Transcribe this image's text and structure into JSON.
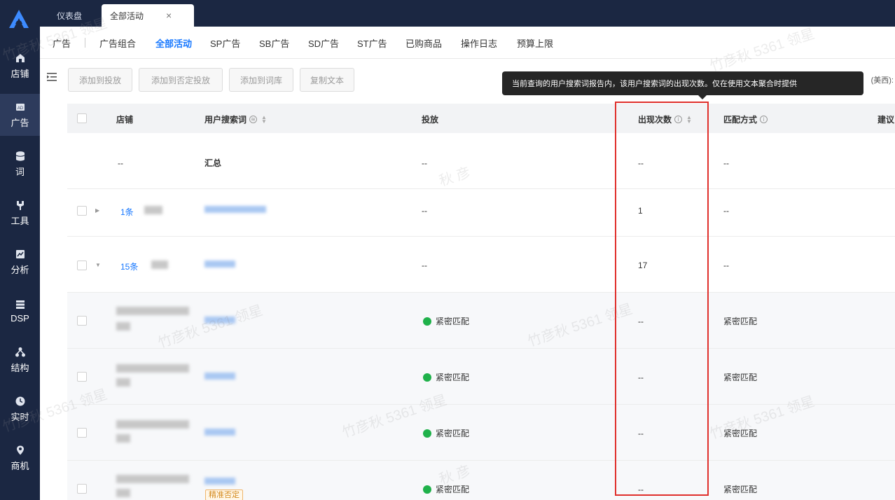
{
  "sidebar": {
    "items": [
      {
        "label": "店铺",
        "icon": "store-icon"
      },
      {
        "label": "广告",
        "icon": "ad-icon",
        "active": true
      },
      {
        "label": "词",
        "icon": "database-icon"
      },
      {
        "label": "工具",
        "icon": "tool-icon"
      },
      {
        "label": "分析",
        "icon": "chart-icon"
      },
      {
        "label": "DSP",
        "icon": "dsp-icon"
      },
      {
        "label": "结构",
        "icon": "structure-icon"
      },
      {
        "label": "实时",
        "icon": "clock-icon"
      },
      {
        "label": "商机",
        "icon": "location-icon"
      }
    ]
  },
  "topbar": {
    "tabs": [
      {
        "label": "仪表盘"
      },
      {
        "label": "全部活动",
        "active": true,
        "close": "×"
      }
    ]
  },
  "subnav": {
    "items": [
      "广告",
      "广告组合",
      "全部活动",
      "SP广告",
      "SB广告",
      "SD广告",
      "ST广告",
      "已购商品",
      "操作日志",
      "预算上限"
    ],
    "active_index": 2
  },
  "toolbar": {
    "buttons": [
      "添加到投放",
      "添加到否定投放",
      "添加到词库",
      "复制文本"
    ],
    "right_label": "(美西):"
  },
  "tooltip": {
    "text": "当前查询的用户搜索词报告内，该用户搜索词的出现次数。仅在使用文本聚合时提供"
  },
  "table": {
    "headers": {
      "store": "店铺",
      "search_term": "用户搜索词",
      "targeting": "投放",
      "occurrences": "出现次数",
      "match_type": "匹配方式",
      "suggest": "建议"
    },
    "summary": {
      "store": "--",
      "search_term": "汇总",
      "targeting": "--",
      "occurrences": "--",
      "match_type": "--"
    },
    "groups": [
      {
        "count": "1条",
        "targeting": "--",
        "occurrences": "1",
        "match_type": "--"
      },
      {
        "count": "15条",
        "targeting": "--",
        "occurrences": "17",
        "match_type": "--"
      }
    ],
    "rows": [
      {
        "targeting": "紧密匹配",
        "occurrences": "--",
        "match_type": "紧密匹配"
      },
      {
        "targeting": "紧密匹配",
        "occurrences": "--",
        "match_type": "紧密匹配"
      },
      {
        "targeting": "紧密匹配",
        "occurrences": "--",
        "match_type": "紧密匹配"
      },
      {
        "targeting": "紧密匹配",
        "occurrences": "--",
        "match_type": "紧密匹配",
        "tag": "精准否定"
      }
    ]
  },
  "watermark": {
    "text": "竹彦秋 5361 领星",
    "short": "秋 彦"
  },
  "colors": {
    "sidebar_bg": "#1b2742",
    "accent": "#1677ff",
    "highlight": "#e0302c",
    "match_dot": "#1fb14a"
  }
}
